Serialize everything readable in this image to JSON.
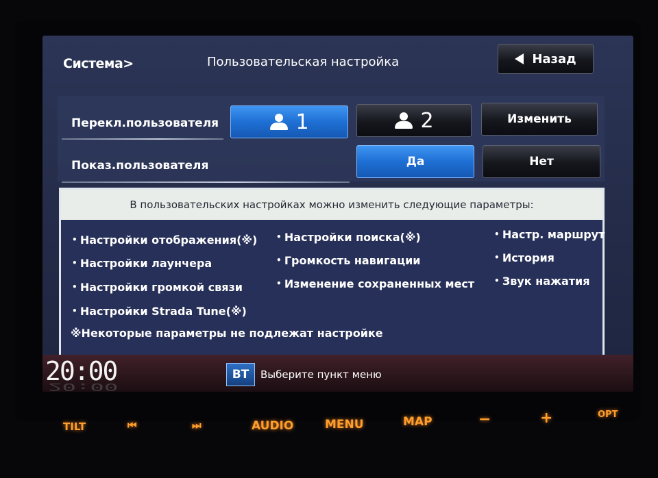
{
  "header": {
    "breadcrumb": "Система>",
    "title": "Пользовательская настройка",
    "back_label": "Назад"
  },
  "switch_user": {
    "label": "Перекл.пользователя",
    "user1": "1",
    "user2": "2",
    "change_label": "Изменить",
    "selected": "1"
  },
  "show_user": {
    "label": "Показ.пользователя",
    "yes": "Да",
    "no": "Нет",
    "selected": "Да"
  },
  "info": {
    "header": "В пользовательских настройках можно изменить следующие параметры:",
    "col1": [
      "Настройки отображения(※)",
      "Настройки лаунчера",
      "Настройки громкой связи",
      "Настройки Strada Tune(※)"
    ],
    "col2": [
      "Настройки поиска(※)",
      "Громкость навигации",
      "Изменение сохраненных мест"
    ],
    "col3": [
      "Настр. маршрут",
      "История",
      "Звук нажатия"
    ],
    "note": "※Некоторые параметры не подлежат настройке"
  },
  "status": {
    "clock": "20:00",
    "bt_badge": "BT",
    "message": "Выберите пункт меню"
  },
  "hardware_buttons": {
    "tilt": "TILT",
    "prev": "⏮",
    "next": "⏭",
    "audio": "AUDIO",
    "menu": "MENU",
    "map": "MAP",
    "minus": "−",
    "plus": "+",
    "opt": "OPT"
  },
  "colors": {
    "accent_blue": "#1e6fd4",
    "screen_bg": "#2c3556",
    "hw_button_glow": "#ff9e2c"
  }
}
